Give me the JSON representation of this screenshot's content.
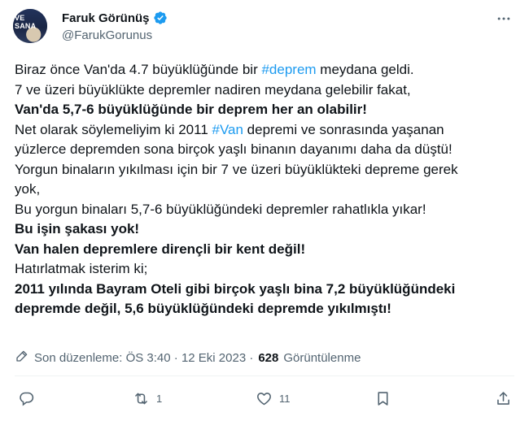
{
  "author": {
    "display_name": "Faruk Görünüş",
    "handle": "@FarukGorunus",
    "avatar_text": "VE SANA",
    "verified": true
  },
  "tweet": {
    "line1": {
      "pre": "Biraz önce Van'da 4.7 büyüklüğünde bir ",
      "tag": "#deprem",
      "post": " meydana geldi."
    },
    "line2": "7 ve üzeri büyüklükte depremler nadiren meydana gelebilir fakat,",
    "line3": "Van'da 5,7-6 büyüklüğünde bir deprem her an olabilir!",
    "line4": {
      "pre": "Net olarak söylemeliyim ki 2011 ",
      "tag": "#Van",
      "post": " depremi ve sonrasında yaşanan"
    },
    "line5": "yüzlerce depremden sona birçok yaşlı binanın dayanımı daha da düştü!",
    "line6": "Yorgun binaların yıkılması için bir 7 ve üzeri büyüklükteki depreme gerek",
    "line7": "yok,",
    "line8": "Bu yorgun binaları 5,7-6 büyüklüğündeki depremler rahatlıkla yıkar!",
    "line9": "Bu işin şakası yok!",
    "line10": "Van halen depremlere dirençli bir kent değil!",
    "line11": "Hatırlatmak isterim ki;",
    "line12": "2011 yılında Bayram Oteli gibi birçok yaşlı bina 7,2 büyüklüğündeki",
    "line13": "depremde değil, 5,6 büyüklüğündeki depremde yıkılmıştı!"
  },
  "meta": {
    "edited_label": "Son düzenleme: ÖS 3:40 · 12 Eki 2023 ·",
    "views_count": "628",
    "views_label": "Görüntülenme"
  },
  "actions": {
    "reply_count": "",
    "retweet_count": "1",
    "like_count": "11",
    "bookmark_count": "",
    "share_count": ""
  },
  "colors": {
    "accent": "#1d9bf0",
    "text": "#0f1419",
    "secondary": "#536471",
    "divider": "#eff3f4"
  },
  "icons": [
    "verified-badge-icon",
    "more-icon",
    "edit-pencil-icon",
    "reply-icon",
    "retweet-icon",
    "like-icon",
    "bookmark-icon",
    "share-icon"
  ]
}
